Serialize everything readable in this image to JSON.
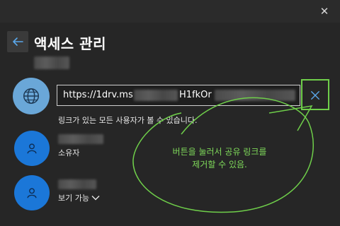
{
  "window": {
    "close_glyph": "✕"
  },
  "header": {
    "title": "액세스 관리",
    "back_icon": "arrow-left-icon"
  },
  "link": {
    "url_start": "https://1drv.ms",
    "url_mid": "H1fkOr",
    "caption": "링크가 있는 모든 사용자가 볼 수 있습니다.",
    "remove_glyph": "✕"
  },
  "people": [
    {
      "role": "소유자"
    },
    {
      "role": "보기 가능",
      "dropdown_glyph": "⌄"
    }
  ],
  "annotation": {
    "line1": "버튼을 눌러서 공유 링크를",
    "line2": "제거할 수 있음."
  },
  "colors": {
    "background": "#262626",
    "accent": "#1b77d8",
    "globe": "#6aa7d8",
    "annotation": "#7fd95a"
  }
}
